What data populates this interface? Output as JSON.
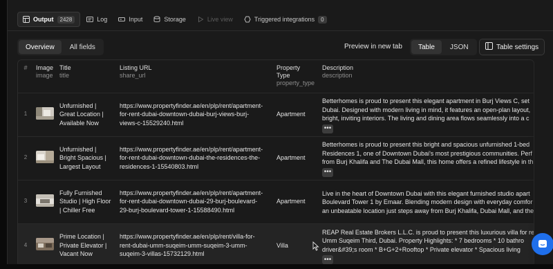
{
  "tabs": [
    {
      "label": "Output",
      "count": "2428",
      "icon": "table-icon",
      "state": "active"
    },
    {
      "label": "Log",
      "icon": "log-icon",
      "state": "normal"
    },
    {
      "label": "Input",
      "icon": "input-icon",
      "state": "normal"
    },
    {
      "label": "Storage",
      "icon": "storage-icon",
      "state": "normal"
    },
    {
      "label": "Live view",
      "icon": "play-icon",
      "state": "disabled"
    },
    {
      "label": "Triggered integrations",
      "count": "0",
      "icon": "integrations-icon",
      "state": "normal"
    }
  ],
  "view": {
    "overview": "Overview",
    "all_fields": "All fields",
    "preview": "Preview in new tab",
    "table": "Table",
    "json": "JSON",
    "settings": "Table settings"
  },
  "columns": {
    "num": "#",
    "image": {
      "title": "Image",
      "sub": "image"
    },
    "title": {
      "title": "Title",
      "sub": "title"
    },
    "url": {
      "title": "Listing URL",
      "sub": "share_url"
    },
    "type": {
      "title": "Property Type",
      "sub": "property_type"
    },
    "desc": {
      "title": "Description",
      "sub": "description"
    }
  },
  "rows": [
    {
      "num": "1",
      "title": [
        "Unfurnished |",
        "Great Location |",
        "Available Now"
      ],
      "url": [
        "https://www.propertyfinder.ae/en/plp/rent/apartment-",
        "for-rent-dubai-downtown-dubai-burj-views-burj-",
        "views-c-15529240.html"
      ],
      "type": "Apartment",
      "desc": [
        "Betterhomes is proud to present this elegant apartment in Burj Views C, set",
        "Dubai. Designed with modern living in mind, it features an open-plan layout,",
        "bright, inviting interiors. The living and dining area flows seamlessly into a c"
      ]
    },
    {
      "num": "2",
      "title": [
        "Unfurnished |",
        "Bright Spacious |",
        "Largest Layout"
      ],
      "url": [
        "https://www.propertyfinder.ae/en/plp/rent/apartment-",
        "for-rent-dubai-downtown-dubai-the-residences-the-",
        "residences-1-15540803.html"
      ],
      "type": "Apartment",
      "desc": [
        "Betterhomes is proud to present this bright and spacious unfurnished 1-bed",
        "Residences 1, one of Downtown Dubai's most prestigious communities. Perf",
        "from Burj Khalifa and The Dubai Mall, this home offers a refined lifestyle in th"
      ]
    },
    {
      "num": "3",
      "title": [
        "Fully Furnished",
        "Studio | High Floor",
        "| Chiller Free"
      ],
      "url": [
        "https://www.propertyfinder.ae/en/plp/rent/apartment-",
        "for-rent-dubai-downtown-dubai-29-burj-boulevard-",
        "29-burj-boulevard-tower-1-15588490.html"
      ],
      "type": "Apartment",
      "desc": [
        "Live in the heart of Downtown Dubai with this elegant furnished studio apart",
        "Boulevard Tower 1 by Emaar. Blending modern design with everyday comfor",
        "an unbeatable location just steps away from Burj Khalifa, Dubai Mall, and the"
      ]
    },
    {
      "num": "4",
      "title": [
        "Prime Location |",
        "Private Elevator |",
        "Vacant Now"
      ],
      "url": [
        "https://www.propertyfinder.ae/en/plp/rent/villa-for-",
        "rent-dubai-umm-suqeim-umm-suqeim-3-umm-",
        "suqeim-3-villas-15732129.html"
      ],
      "type": "Villa",
      "desc": [
        "REAP Real Estate Brokers L.L.C. is proud to present this luxurious villa for re",
        "Umm Suqeim Third, Dubai. Property Highlights: * 7 bedrooms * 10 bathro",
        "driver&#39;s room * B+G+2+Rooftop * Private elevator * Spacious living"
      ]
    }
  ],
  "more_glyph": "•••"
}
